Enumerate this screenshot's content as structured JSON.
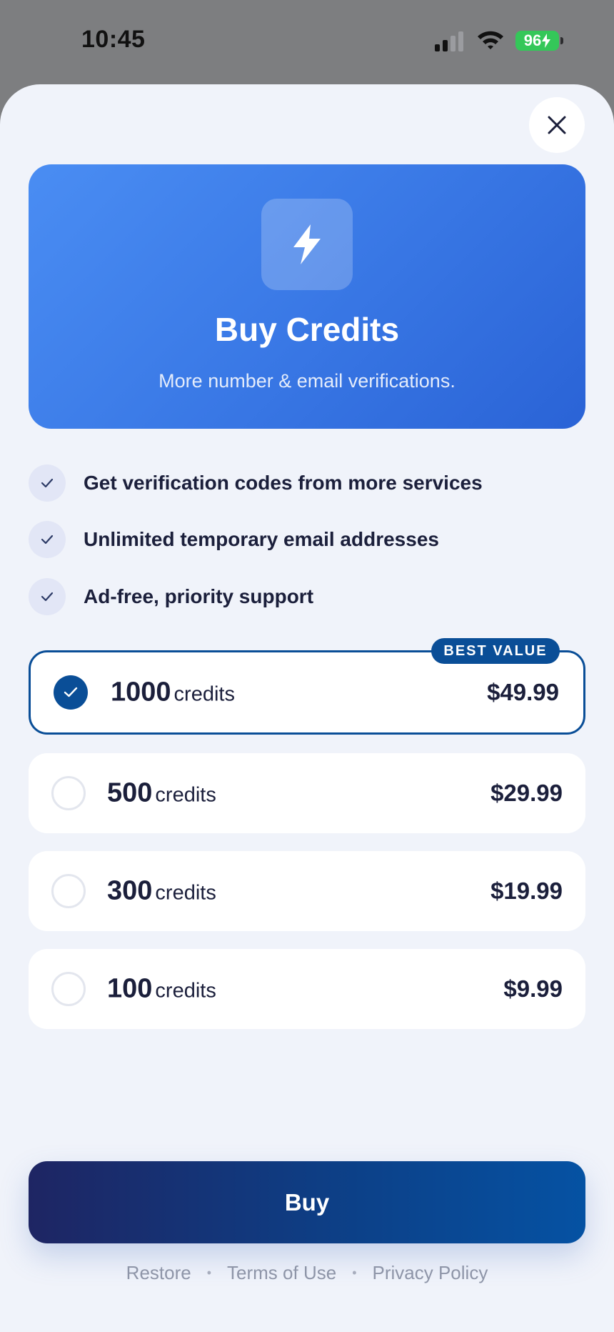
{
  "status_bar": {
    "time": "10:45",
    "battery": "96"
  },
  "hero": {
    "title": "Buy Credits",
    "subtitle": "More number & email verifications."
  },
  "features": [
    "Get verification codes from more services",
    "Unlimited temporary email addresses",
    "Ad-free, priority support"
  ],
  "plans": [
    {
      "amount": "1000",
      "unit": "credits",
      "price": "$49.99"
    },
    {
      "amount": "500",
      "unit": "credits",
      "price": "$29.99"
    },
    {
      "amount": "300",
      "unit": "credits",
      "price": "$19.99"
    },
    {
      "amount": "100",
      "unit": "credits",
      "price": "$9.99"
    }
  ],
  "badge": "BEST VALUE",
  "buy_label": "Buy",
  "footer": {
    "restore": "Restore",
    "terms": "Terms of Use",
    "privacy": "Privacy Policy"
  },
  "colors": {
    "accent": "#0a4e97",
    "hero_gradient_start": "#4a8df3",
    "hero_gradient_end": "#2a63d6",
    "sheet_background": "#f0f3fa",
    "battery": "#34c759"
  },
  "icons": [
    "cellular-signal-icon",
    "wifi-icon",
    "battery-charging-icon",
    "close-icon",
    "lightning-bolt-icon",
    "checkmark-icon"
  ]
}
